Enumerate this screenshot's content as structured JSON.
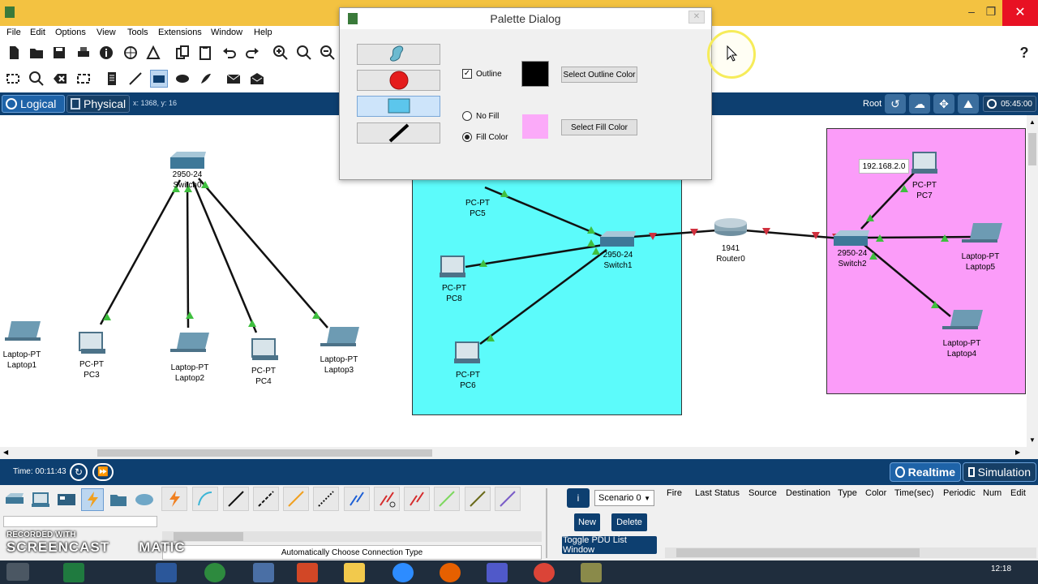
{
  "menu": [
    "File",
    "Edit",
    "Options",
    "View",
    "Tools",
    "Extensions",
    "Window",
    "Help"
  ],
  "modebar": {
    "logical": "Logical",
    "physical": "Physical",
    "coords": "x: 1368, y: 16",
    "root": "Root",
    "clock": "05:45:00"
  },
  "dialog": {
    "title": "Palette Dialog",
    "outline_label": "Outline",
    "outline_checked": true,
    "outline_color": "#000000",
    "select_outline": "Select Outline Color",
    "no_fill": "No Fill",
    "fill_color_label": "Fill Color",
    "fill_selected": "Fill Color",
    "fill_color": "#fbaaf9",
    "select_fill": "Select Fill Color"
  },
  "devices": {
    "switch0": [
      "2950-24",
      "Switch0"
    ],
    "laptop1": [
      "Laptop-PT",
      "Laptop1"
    ],
    "pc3": [
      "PC-PT",
      "PC3"
    ],
    "laptop2": [
      "Laptop-PT",
      "Laptop2"
    ],
    "pc4": [
      "PC-PT",
      "PC4"
    ],
    "laptop3": [
      "Laptop-PT",
      "Laptop3"
    ],
    "pc5": [
      "PC-PT",
      "PC5"
    ],
    "pc8": [
      "PC-PT",
      "PC8"
    ],
    "pc6": [
      "PC-PT",
      "PC6"
    ],
    "switch1": [
      "2950-24",
      "Switch1"
    ],
    "router0": [
      "1941",
      "Router0"
    ],
    "switch2": [
      "2950-24",
      "Switch2"
    ],
    "pc7": [
      "PC-PT",
      "PC7"
    ],
    "laptop5": [
      "Laptop-PT",
      "Laptop5"
    ],
    "laptop4": [
      "Laptop-PT",
      "Laptop4"
    ]
  },
  "ip_label": "192.168.2.0",
  "cluster_colors": {
    "cyan": "#5cfbfb",
    "pink": "#fb9cf9"
  },
  "bottom": {
    "time": "Time: 00:11:43",
    "realtime": "Realtime",
    "simulation": "Simulation",
    "conn_caption": "Automatically Choose Connection Type",
    "scenario": "Scenario 0",
    "new": "New",
    "delete": "Delete",
    "toggle": "Toggle PDU List Window",
    "pdu_columns": [
      "Fire",
      "Last Status",
      "Source",
      "Destination",
      "Type",
      "Color",
      "Time(sec)",
      "Periodic",
      "Num",
      "Edit"
    ]
  },
  "watermark": {
    "line1": "RECORDED WITH",
    "line2": "SCREENCAST",
    "line3": "MATIC"
  },
  "taskbar_time": "12:18"
}
